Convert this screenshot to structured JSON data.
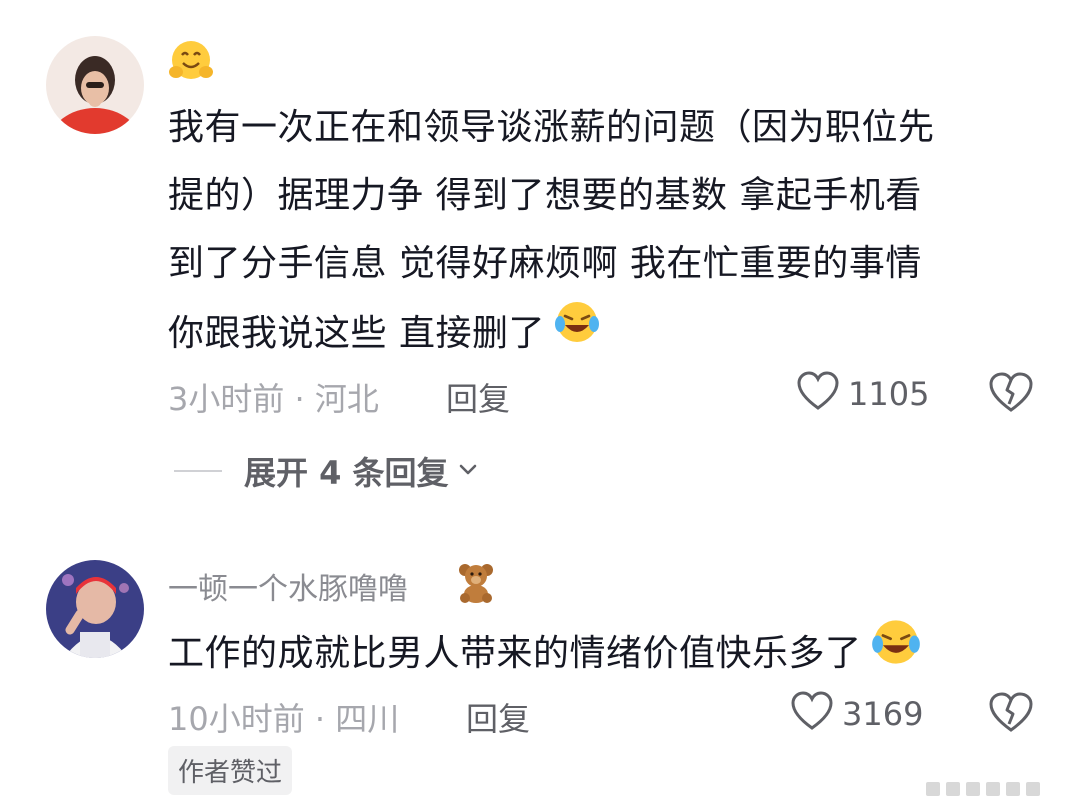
{
  "comments": [
    {
      "author": "",
      "author_emoji_icon": "hugging-face-emoji-icon",
      "text_lines": [
        "我有一次正在和领导谈涨薪的问题（因为职位先",
        "提的）据理力争 得到了想要的基数 拿起手机看",
        "到了分手信息 觉得好麻烦啊 我在忙重要的事情",
        "你跟我说这些 直接删了"
      ],
      "text_end_icon": "laughing-tears-emoji-icon",
      "meta": "3小时前 · 河北",
      "reply_label": "回复",
      "likes": "1105",
      "expand_label": "展开 4 条回复"
    },
    {
      "author": "一顿一个水豚噜噜",
      "author_emoji_icon": "teddy-bear-emoji-icon",
      "text_lines": [
        "工作的成就比男人带来的情绪价值快乐多了"
      ],
      "text_end_icon": "laughing-tears-emoji-icon",
      "meta": "10小时前 · 四川",
      "reply_label": "回复",
      "likes": "3169",
      "badge": "作者赞过"
    }
  ],
  "colors": {
    "text": "#161823",
    "meta": "#a6a7ad",
    "action": "#5f6066",
    "badge_bg": "#f1f1f2"
  }
}
